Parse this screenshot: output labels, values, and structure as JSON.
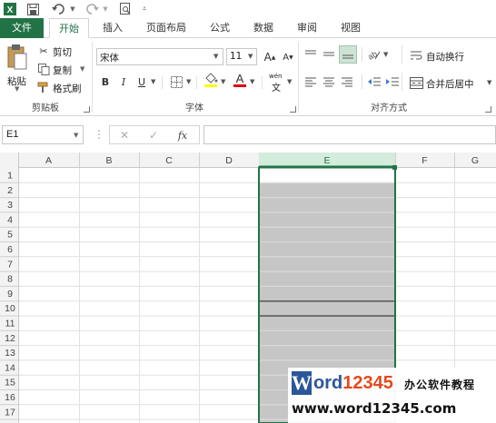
{
  "quick_access": {
    "app_icon": "excel-logo-icon",
    "save_icon": "save-icon",
    "undo_icon": "undo-icon",
    "redo_icon": "redo-icon",
    "preview_icon": "print-preview-icon"
  },
  "tabs": [
    {
      "label": "文件",
      "type": "file"
    },
    {
      "label": "开始",
      "type": "active"
    },
    {
      "label": "插入",
      "type": "normal"
    },
    {
      "label": "页面布局",
      "type": "normal"
    },
    {
      "label": "公式",
      "type": "normal"
    },
    {
      "label": "数据",
      "type": "normal"
    },
    {
      "label": "审阅",
      "type": "normal"
    },
    {
      "label": "视图",
      "type": "normal"
    }
  ],
  "ribbon": {
    "clipboard": {
      "paste_label": "粘贴",
      "cut_label": "剪切",
      "copy_label": "复制",
      "format_painter_label": "格式刷",
      "group_label": "剪贴板"
    },
    "font": {
      "font_name": "宋体",
      "font_size": "11",
      "bold": "B",
      "italic": "I",
      "underline": "U",
      "grow": "A",
      "shrink": "A",
      "phonetic": "wén",
      "group_label": "字体"
    },
    "alignment": {
      "wrap_label": "自动换行",
      "merge_label": "合并后居中",
      "group_label": "对齐方式"
    }
  },
  "formula_bar": {
    "name_box": "E1",
    "fx": "fx",
    "value": ""
  },
  "sheet": {
    "columns": [
      "A",
      "B",
      "C",
      "D",
      "E",
      "F",
      "G"
    ],
    "rows": [
      "1",
      "2",
      "3",
      "4",
      "5",
      "6",
      "7",
      "8",
      "9",
      "10",
      "11",
      "12",
      "13",
      "14",
      "15",
      "16",
      "17"
    ],
    "selected_column": "E"
  },
  "watermark": {
    "brand": "Word12345",
    "tagline": "办公软件教程",
    "url": "www.word12345.com"
  },
  "colors": {
    "accent": "#217346",
    "selection_fill": "#c6c6c6",
    "header_selected": "#d3ecdc"
  }
}
